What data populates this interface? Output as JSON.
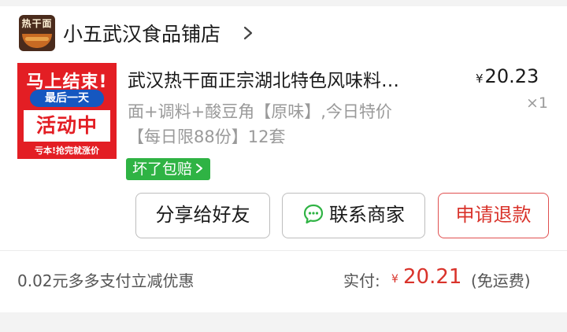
{
  "store": {
    "logo_text": "热干面",
    "name": "小五武汉食品铺店"
  },
  "product": {
    "image": {
      "top_text": "马上结束!",
      "badge_text": "最后一天",
      "box_text": "活动中",
      "bottom_text": "亏本!抢完就涨价"
    },
    "title": "武汉热干面正宗湖北特色风味料…",
    "currency": "¥",
    "price": "20.23",
    "spec_line1": "面+调料+酸豆角【原味】,今日特价",
    "spec_line2": "【每日限88份】12套",
    "quantity": "×1",
    "guarantee_badge": "坏了包赔",
    "guarantee_color": "#2fb344"
  },
  "actions": {
    "share": "分享给好友",
    "contact": "联系商家",
    "refund": "申请退款"
  },
  "summary": {
    "discount_text": "0.02元多多支付立减优惠",
    "paid_label": "实付:",
    "currency": "¥",
    "paid_amount": "20.21",
    "paid_note": "(免运费)",
    "accent_color": "#d9332b"
  }
}
